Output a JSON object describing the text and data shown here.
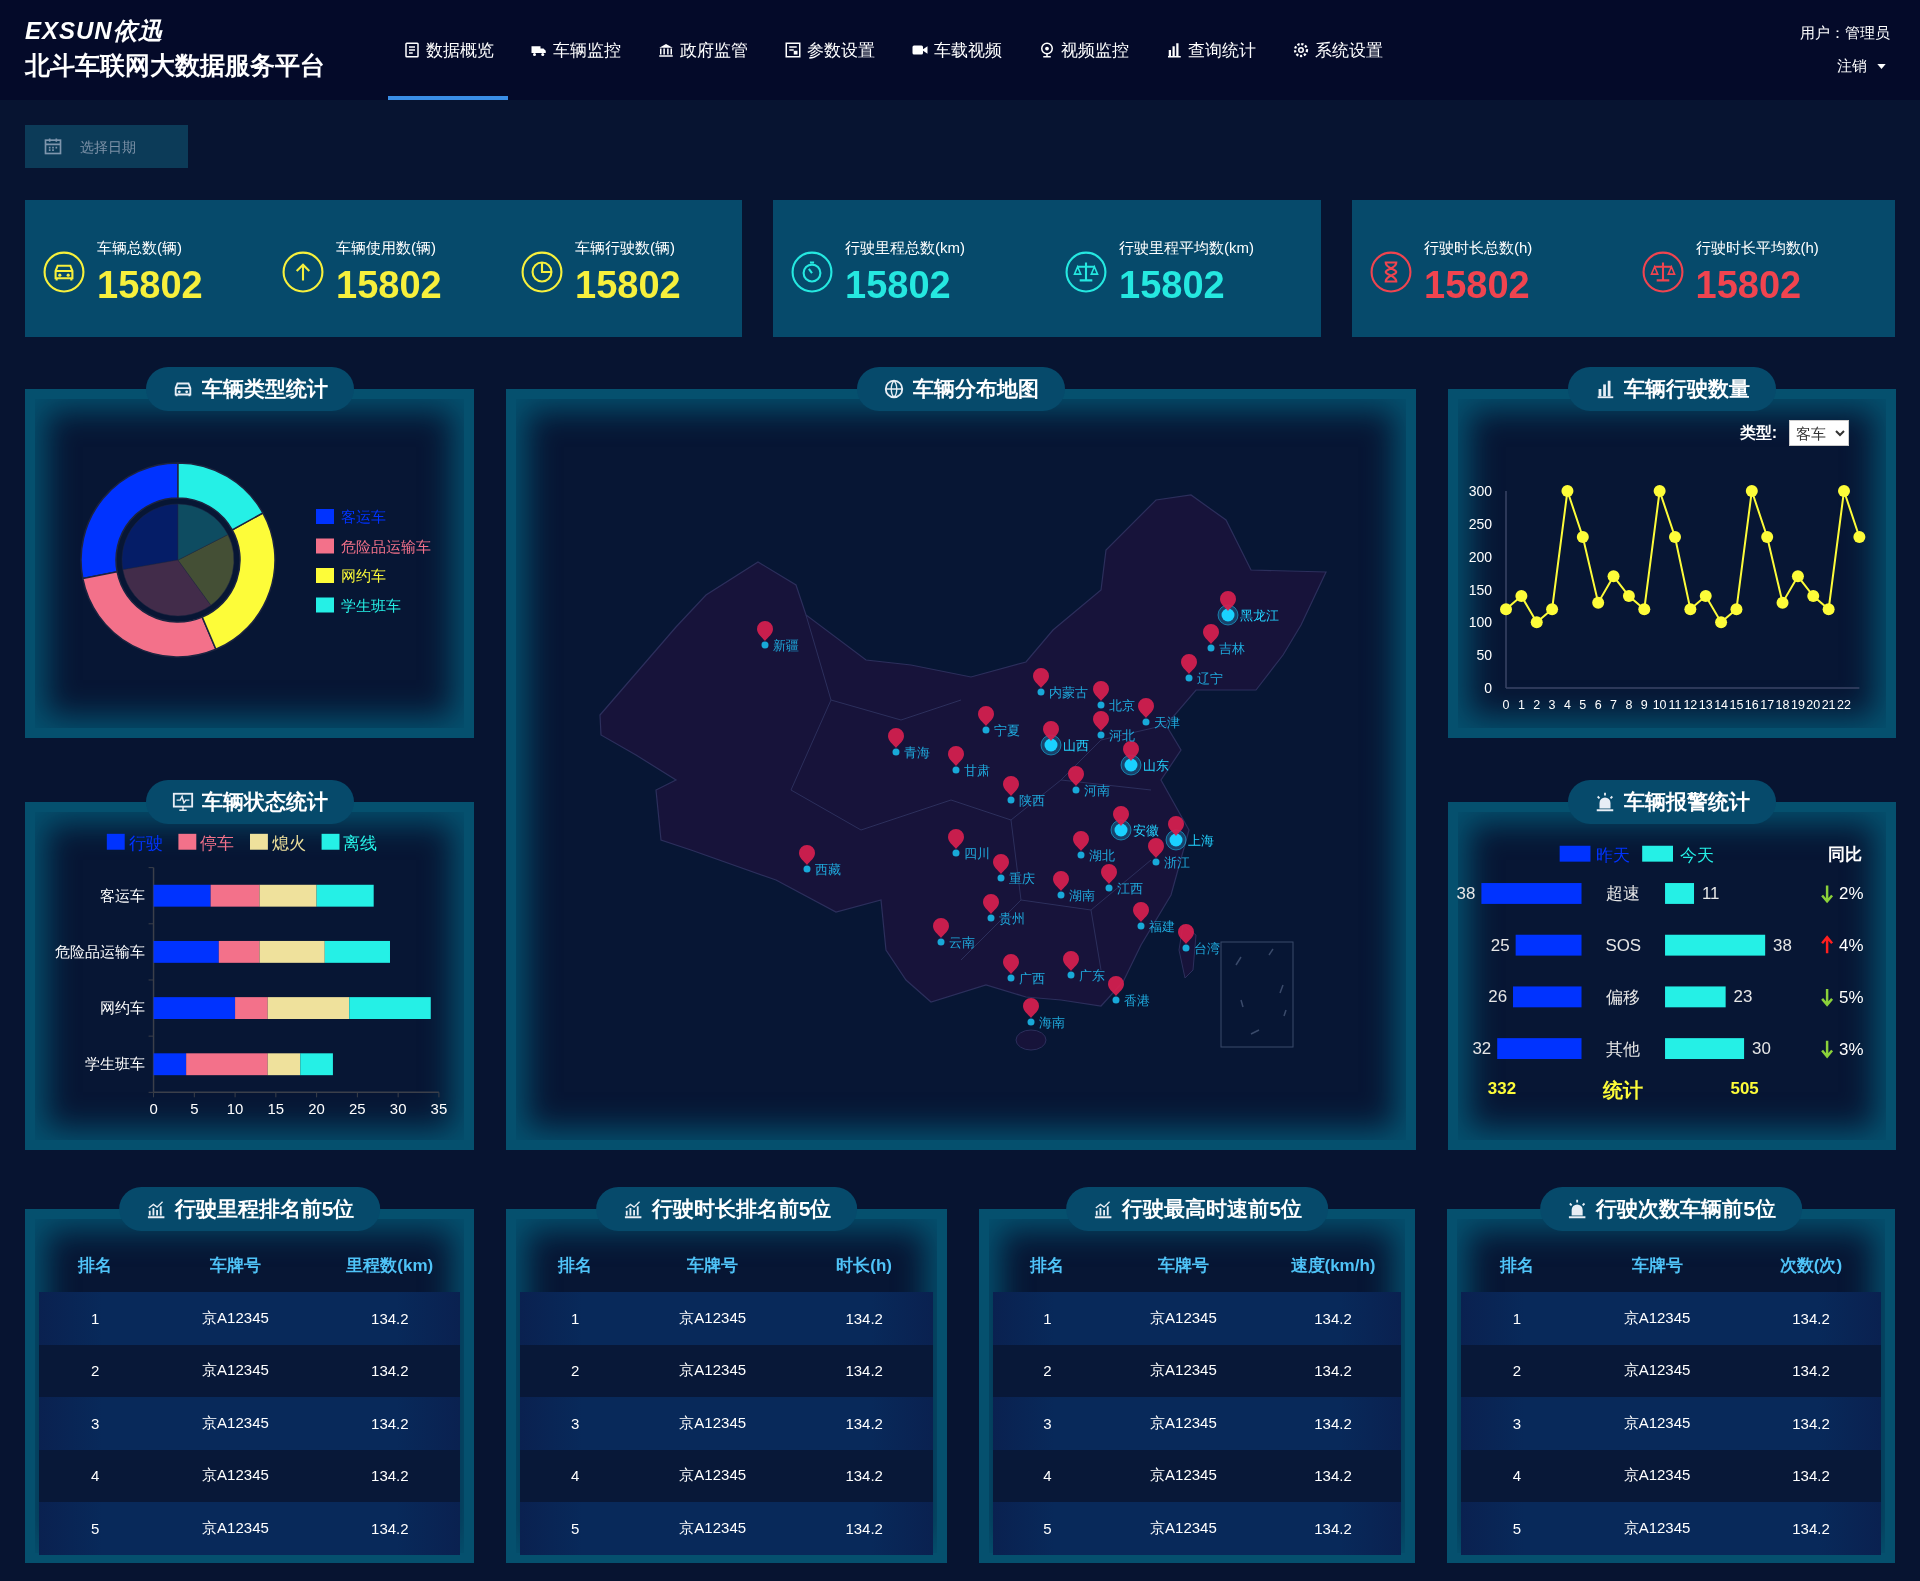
{
  "header": {
    "logo": "EXSUN依迅",
    "title": "北斗车联网大数据服务平台",
    "nav": [
      {
        "label": "数据概览",
        "selected": true
      },
      {
        "label": "车辆监控",
        "selected": false
      },
      {
        "label": "政府监管",
        "selected": false
      },
      {
        "label": "参数设置",
        "selected": false
      },
      {
        "label": "车载视频",
        "selected": false
      },
      {
        "label": "视频监控",
        "selected": false
      },
      {
        "label": "查询统计",
        "selected": false
      },
      {
        "label": "系统设置",
        "selected": false
      }
    ],
    "user": "用户：管理员",
    "logout": "注销"
  },
  "date_picker": {
    "placeholder": "选择日期"
  },
  "stat_groups": [
    {
      "color": "#f7f03c",
      "items": [
        {
          "label": "车辆总数(辆)",
          "value": "15802"
        },
        {
          "label": "车辆使用数(辆)",
          "value": "15802"
        },
        {
          "label": "车辆行驶数(辆)",
          "value": "15802"
        }
      ]
    },
    {
      "color": "#25e8e0",
      "items": [
        {
          "label": "行驶里程总数(km)",
          "value": "15802"
        },
        {
          "label": "行驶里程平均数(km)",
          "value": "15802"
        }
      ]
    },
    {
      "color": "#f0444f",
      "items": [
        {
          "label": "行驶时长总数(h)",
          "value": "15802"
        },
        {
          "label": "行驶时长平均数(h)",
          "value": "15802"
        }
      ]
    }
  ],
  "vehicle_types": {
    "title": "车辆类型统计",
    "legend": [
      {
        "label": "客运车",
        "color": "#0033ff"
      },
      {
        "label": "危险品运输车",
        "color": "#f3718a"
      },
      {
        "label": "网约车",
        "color": "#fdfc39"
      },
      {
        "label": "学生班车",
        "color": "#25f0e6"
      }
    ]
  },
  "vehicle_status": {
    "title": "车辆状态统计",
    "chart_data": {
      "type": "bar",
      "orientation": "horizontal",
      "stacked": true,
      "categories": [
        "客运车",
        "危险品运输车",
        "网约车",
        "学生班车"
      ],
      "series": [
        {
          "name": "行驶",
          "color": "#0033ff",
          "values": [
            7,
            8,
            10,
            4
          ]
        },
        {
          "name": "停车",
          "color": "#f3718a",
          "values": [
            6,
            5,
            4,
            10
          ]
        },
        {
          "name": "熄火",
          "color": "#efe19c",
          "values": [
            7,
            8,
            10,
            4
          ]
        },
        {
          "name": "离线",
          "color": "#25f0e6",
          "values": [
            7,
            8,
            10,
            4
          ]
        }
      ],
      "xlim": [
        0,
        35
      ],
      "xticks": [
        0,
        5,
        10,
        15,
        20,
        25,
        30,
        35
      ],
      "legend": "top"
    }
  },
  "map": {
    "title": "车辆分布地图",
    "markers": [
      {
        "label": "新疆",
        "highlighted": false
      },
      {
        "label": "西藏",
        "highlighted": false
      },
      {
        "label": "青海",
        "highlighted": false
      },
      {
        "label": "甘肃",
        "highlighted": false
      },
      {
        "label": "宁夏",
        "highlighted": false
      },
      {
        "label": "内蒙古",
        "highlighted": false
      },
      {
        "label": "北京",
        "highlighted": false
      },
      {
        "label": "天津",
        "highlighted": false
      },
      {
        "label": "河北",
        "highlighted": false
      },
      {
        "label": "山西",
        "highlighted": true
      },
      {
        "label": "山东",
        "highlighted": true
      },
      {
        "label": "河南",
        "highlighted": false
      },
      {
        "label": "陕西",
        "highlighted": false
      },
      {
        "label": "四川",
        "highlighted": false
      },
      {
        "label": "重庆",
        "highlighted": false
      },
      {
        "label": "贵州",
        "highlighted": false
      },
      {
        "label": "云南",
        "highlighted": false
      },
      {
        "label": "广西",
        "highlighted": false
      },
      {
        "label": "广东",
        "highlighted": false
      },
      {
        "label": "香港",
        "highlighted": false
      },
      {
        "label": "海南",
        "highlighted": false
      },
      {
        "label": "湖北",
        "highlighted": false
      },
      {
        "label": "湖南",
        "highlighted": false
      },
      {
        "label": "江西",
        "highlighted": false
      },
      {
        "label": "安徽",
        "highlighted": true
      },
      {
        "label": "上海",
        "highlighted": true
      },
      {
        "label": "浙江",
        "highlighted": false
      },
      {
        "label": "福建",
        "highlighted": false
      },
      {
        "label": "台湾",
        "highlighted": false
      },
      {
        "label": "黑龙江",
        "highlighted": true
      },
      {
        "label": "吉林",
        "highlighted": false
      },
      {
        "label": "辽宁",
        "highlighted": false
      }
    ]
  },
  "driving_count": {
    "title": "车辆行驶数量",
    "filter_label": "类型:",
    "filter_value": "客车",
    "chart_data": {
      "type": "line",
      "x": [
        0,
        1,
        2,
        3,
        4,
        5,
        6,
        7,
        8,
        9,
        10,
        11,
        12,
        13,
        14,
        15,
        16,
        17,
        18,
        19,
        20,
        21,
        22,
        23
      ],
      "values": [
        120,
        140,
        100,
        120,
        300,
        230,
        130,
        170,
        140,
        120,
        300,
        230,
        120,
        140,
        100,
        120,
        300,
        230,
        130,
        170,
        140,
        120,
        300,
        230
      ],
      "xlim": [
        0,
        23
      ],
      "marker": true,
      "xticks": [
        0,
        1,
        2,
        3,
        4,
        5,
        6,
        7,
        8,
        9,
        10,
        11,
        12,
        13,
        14,
        15,
        16,
        17,
        18,
        19,
        20,
        21,
        22
      ],
      "ylim": [
        0,
        300
      ],
      "yticks": [
        0,
        50,
        100,
        150,
        200,
        250,
        300
      ]
    }
  },
  "alarms": {
    "title": "车辆报警统计",
    "yesterday": {
      "chart_data": {
        "type": "bar",
        "orientation": "horizontal",
        "series": [
          {
            "name": "昨天",
            "color": "#0033ff",
            "values": [
              38,
              25,
              26,
              32
            ]
          }
        ],
        "data_labels": true
      }
    },
    "today": {
      "chart_data": {
        "type": "bar",
        "orientation": "horizontal",
        "categories": [
          "超速",
          "SOS",
          "偏移",
          "其他"
        ],
        "series": [
          {
            "name": "今天",
            "color": "#25f0e6",
            "values": [
              11,
              38,
              23,
              30
            ]
          }
        ],
        "data_labels": true
      }
    },
    "change_header": "同比",
    "changes": [
      {
        "kind": "down",
        "color": "#8bd13a",
        "value": "2%"
      },
      {
        "kind": "up",
        "color": "#ff1f1f",
        "value": "4%"
      },
      {
        "kind": "down",
        "color": "#8bd13a",
        "value": "5%"
      },
      {
        "kind": "down",
        "color": "#8bd13a",
        "value": "3%"
      }
    ],
    "totals": {
      "yesterday": "332",
      "label": "统计",
      "today": "505"
    }
  },
  "tables": [
    {
      "title": "行驶里程排名前5位",
      "columns": [
        "排名",
        "车牌号",
        "里程数(km)"
      ],
      "rows": [
        [
          "1",
          "京A12345",
          "134.2"
        ],
        [
          "2",
          "京A12345",
          "134.2"
        ],
        [
          "3",
          "京A12345",
          "134.2"
        ],
        [
          "4",
          "京A12345",
          "134.2"
        ],
        [
          "5",
          "京A12345",
          "134.2"
        ]
      ]
    },
    {
      "title": "行驶时长排名前5位",
      "columns": [
        "排名",
        "车牌号",
        "时长(h)"
      ],
      "rows": [
        [
          "1",
          "京A12345",
          "134.2"
        ],
        [
          "2",
          "京A12345",
          "134.2"
        ],
        [
          "3",
          "京A12345",
          "134.2"
        ],
        [
          "4",
          "京A12345",
          "134.2"
        ],
        [
          "5",
          "京A12345",
          "134.2"
        ]
      ]
    },
    {
      "title": "行驶最高时速前5位",
      "columns": [
        "排名",
        "车牌号",
        "速度(km/h)"
      ],
      "rows": [
        [
          "1",
          "京A12345",
          "134.2"
        ],
        [
          "2",
          "京A12345",
          "134.2"
        ],
        [
          "3",
          "京A12345",
          "134.2"
        ],
        [
          "4",
          "京A12345",
          "134.2"
        ],
        [
          "5",
          "京A12345",
          "134.2"
        ]
      ]
    },
    {
      "title": "行驶次数车辆前5位",
      "columns": [
        "排名",
        "车牌号",
        "次数(次)"
      ],
      "rows": [
        [
          "1",
          "京A12345",
          "134.2"
        ],
        [
          "2",
          "京A12345",
          "134.2"
        ],
        [
          "3",
          "京A12345",
          "134.2"
        ],
        [
          "4",
          "京A12345",
          "134.2"
        ],
        [
          "5",
          "京A12345",
          "134.2"
        ]
      ]
    }
  ]
}
